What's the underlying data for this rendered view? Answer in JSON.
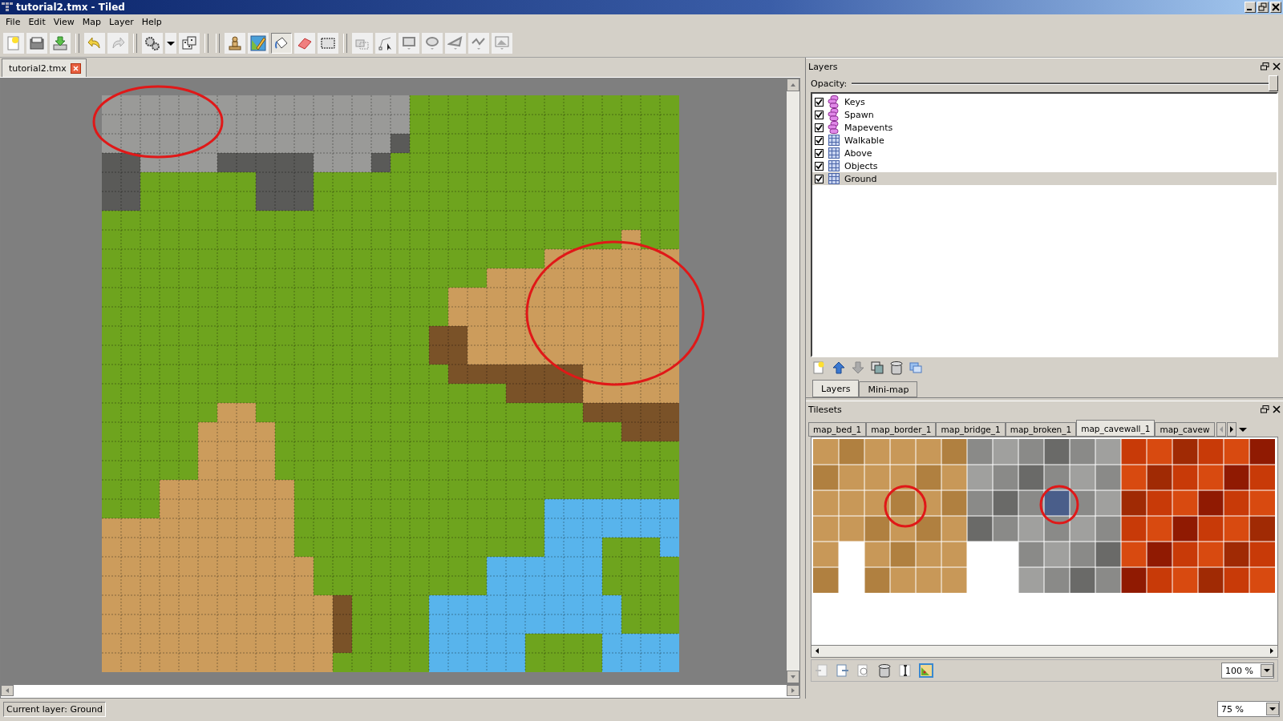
{
  "window": {
    "title": "tutorial2.tmx - Tiled"
  },
  "menu": [
    "File",
    "Edit",
    "View",
    "Map",
    "Layer",
    "Help"
  ],
  "toolbar": {
    "tools": [
      {
        "kind": "stamp",
        "selected": false
      },
      {
        "kind": "terrain",
        "selected": false
      },
      {
        "kind": "fill",
        "selected": true
      },
      {
        "kind": "eraser",
        "selected": false
      },
      {
        "kind": "rect-select",
        "selected": false
      }
    ]
  },
  "document_tabs": [
    {
      "label": "tutorial2.tmx",
      "selected": true
    }
  ],
  "layers_panel": {
    "title": "Layers",
    "opacity_label": "Opacity:",
    "opacity": {
      "level": 1
    },
    "layers": [
      {
        "name": "Keys",
        "kind": "object",
        "visible": true,
        "selected": false
      },
      {
        "name": "Spawn",
        "kind": "object",
        "visible": true,
        "selected": false
      },
      {
        "name": "Mapevents",
        "kind": "object",
        "visible": true,
        "selected": false
      },
      {
        "name": "Walkable",
        "kind": "tile",
        "visible": true,
        "selected": false
      },
      {
        "name": "Above",
        "kind": "tile",
        "visible": true,
        "selected": false
      },
      {
        "name": "Objects",
        "kind": "tile",
        "visible": true,
        "selected": false
      },
      {
        "name": "Ground",
        "kind": "tile",
        "visible": true,
        "selected": true
      }
    ],
    "tabs": [
      {
        "label": "Layers",
        "selected": true
      },
      {
        "label": "Mini-map",
        "selected": false
      }
    ]
  },
  "tilesets_panel": {
    "title": "Tilesets",
    "tabs": [
      {
        "label": "map_bed_1",
        "selected": false
      },
      {
        "label": "map_border_1",
        "selected": false
      },
      {
        "label": "map_bridge_1",
        "selected": false
      },
      {
        "label": "map_broken_1",
        "selected": false
      },
      {
        "label": "map_cavewall_1",
        "selected": true
      },
      {
        "label": "map_cavew",
        "selected": false
      }
    ],
    "zoom": "100 %"
  },
  "status_bar": {
    "text": "Current layer: Ground",
    "zoom": "75 %"
  }
}
